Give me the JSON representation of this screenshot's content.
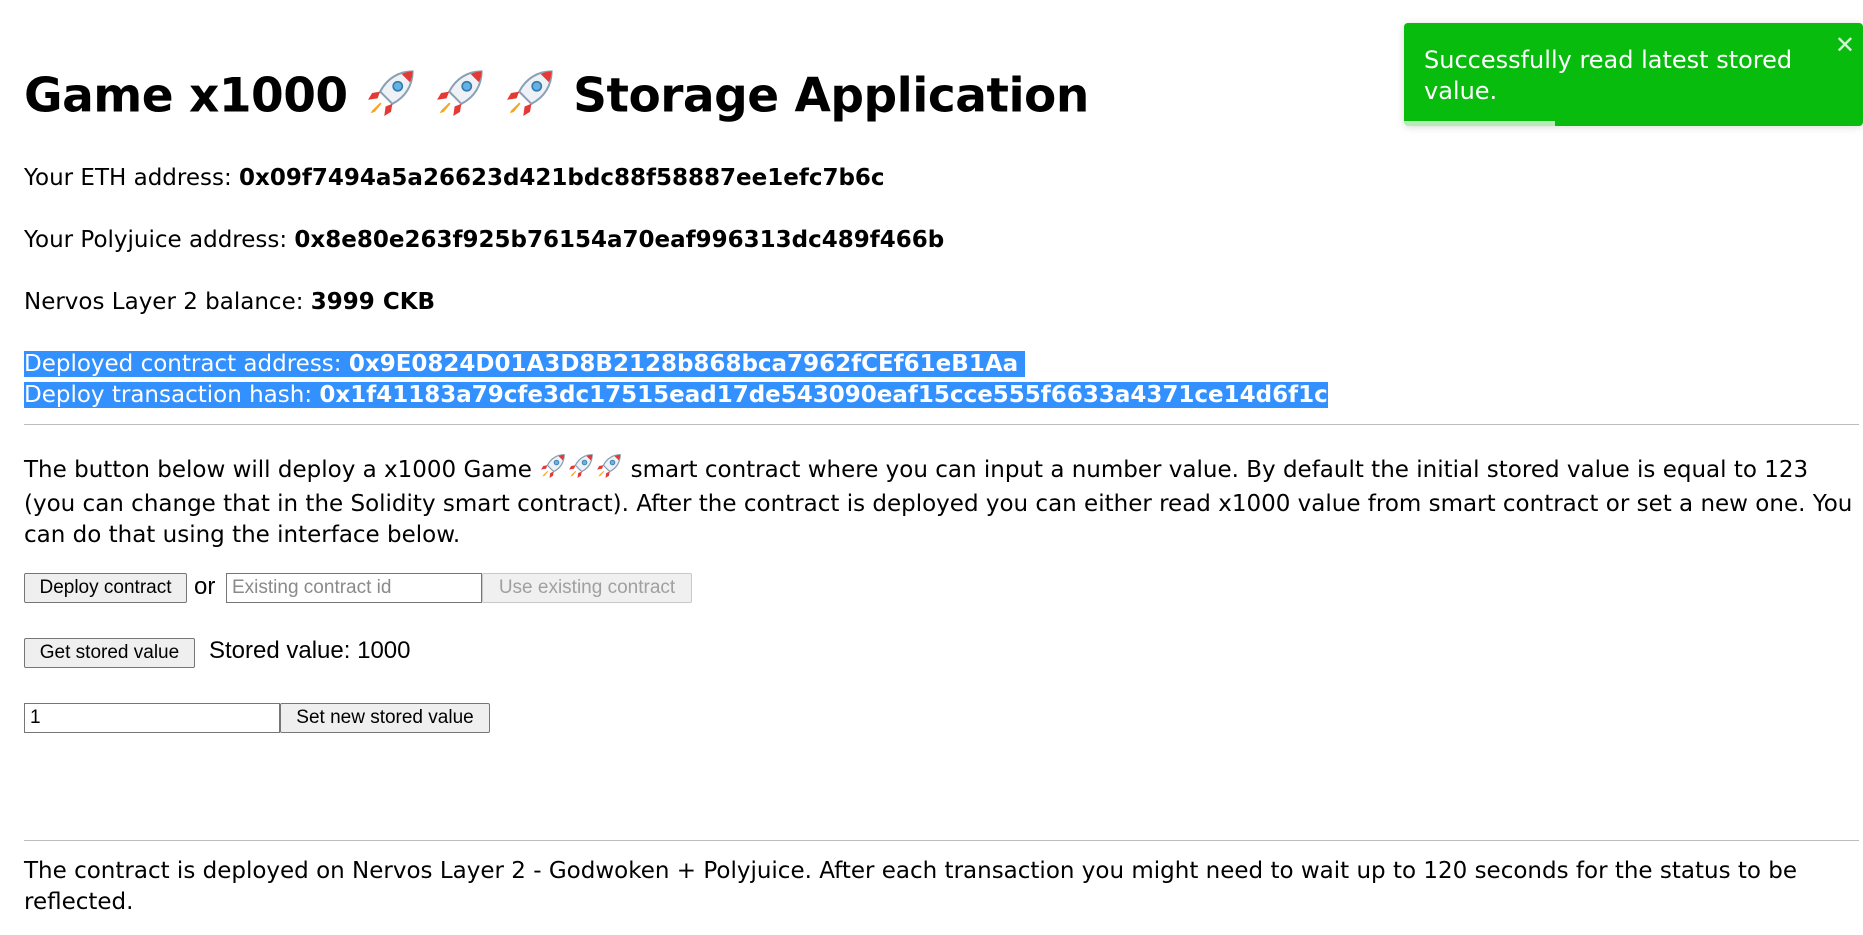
{
  "app": {
    "title_prefix": "Game x1000",
    "title_suffix": "Storage Application"
  },
  "account": {
    "eth_label": "Your ETH address:",
    "eth_address": "0x09f7494a5a26623d421bdc88f58887ee1efc7b6c",
    "polyjuice_label": "Your Polyjuice address:",
    "polyjuice_address": "0x8e80e263f925b76154a70eaf996313dc489f466b",
    "balance_label": "Nervos Layer 2 balance:",
    "balance_value": "3999 CKB"
  },
  "deployment": {
    "contract_label": "Deployed contract address:",
    "contract_address": "0x9E0824D01A3D8B2128b868bca7962fCEf61eB1Aa",
    "tx_label": "Deploy transaction hash:",
    "tx_hash": "0x1f41183a79cfe3dc17515ead17de543090eaf15cce555f6633a4371ce14d6f1c"
  },
  "description": {
    "part1": "The button below will deploy a x1000 Game",
    "part2": "smart contract where you can input a number value. By default the initial stored value is equal to 123 (you can change that in the Solidity smart contract). After the contract is deployed you can either read x1000 value from smart contract or set a new one. You can do that using the interface below."
  },
  "controls": {
    "deploy_label": "Deploy contract",
    "or_text": "or",
    "existing_placeholder": "Existing contract id",
    "use_existing_label": "Use existing contract",
    "get_label": "Get stored value",
    "stored_text": "Stored value: 1000",
    "new_value": "1",
    "set_label": "Set new stored value"
  },
  "footer": {
    "text": "The contract is deployed on Nervos Layer 2 - Godwoken + Polyjuice. After each transaction you might need to wait up to 120 seconds for the status to be reflected."
  },
  "toast": {
    "message": "Successfully read latest stored value.",
    "close_symbol": "✕",
    "progress_remaining": 0.33
  },
  "colors": {
    "toast_success": "#07bc0c",
    "selection_highlight": "#3390ff"
  },
  "icons": [
    "rocket-icon"
  ]
}
